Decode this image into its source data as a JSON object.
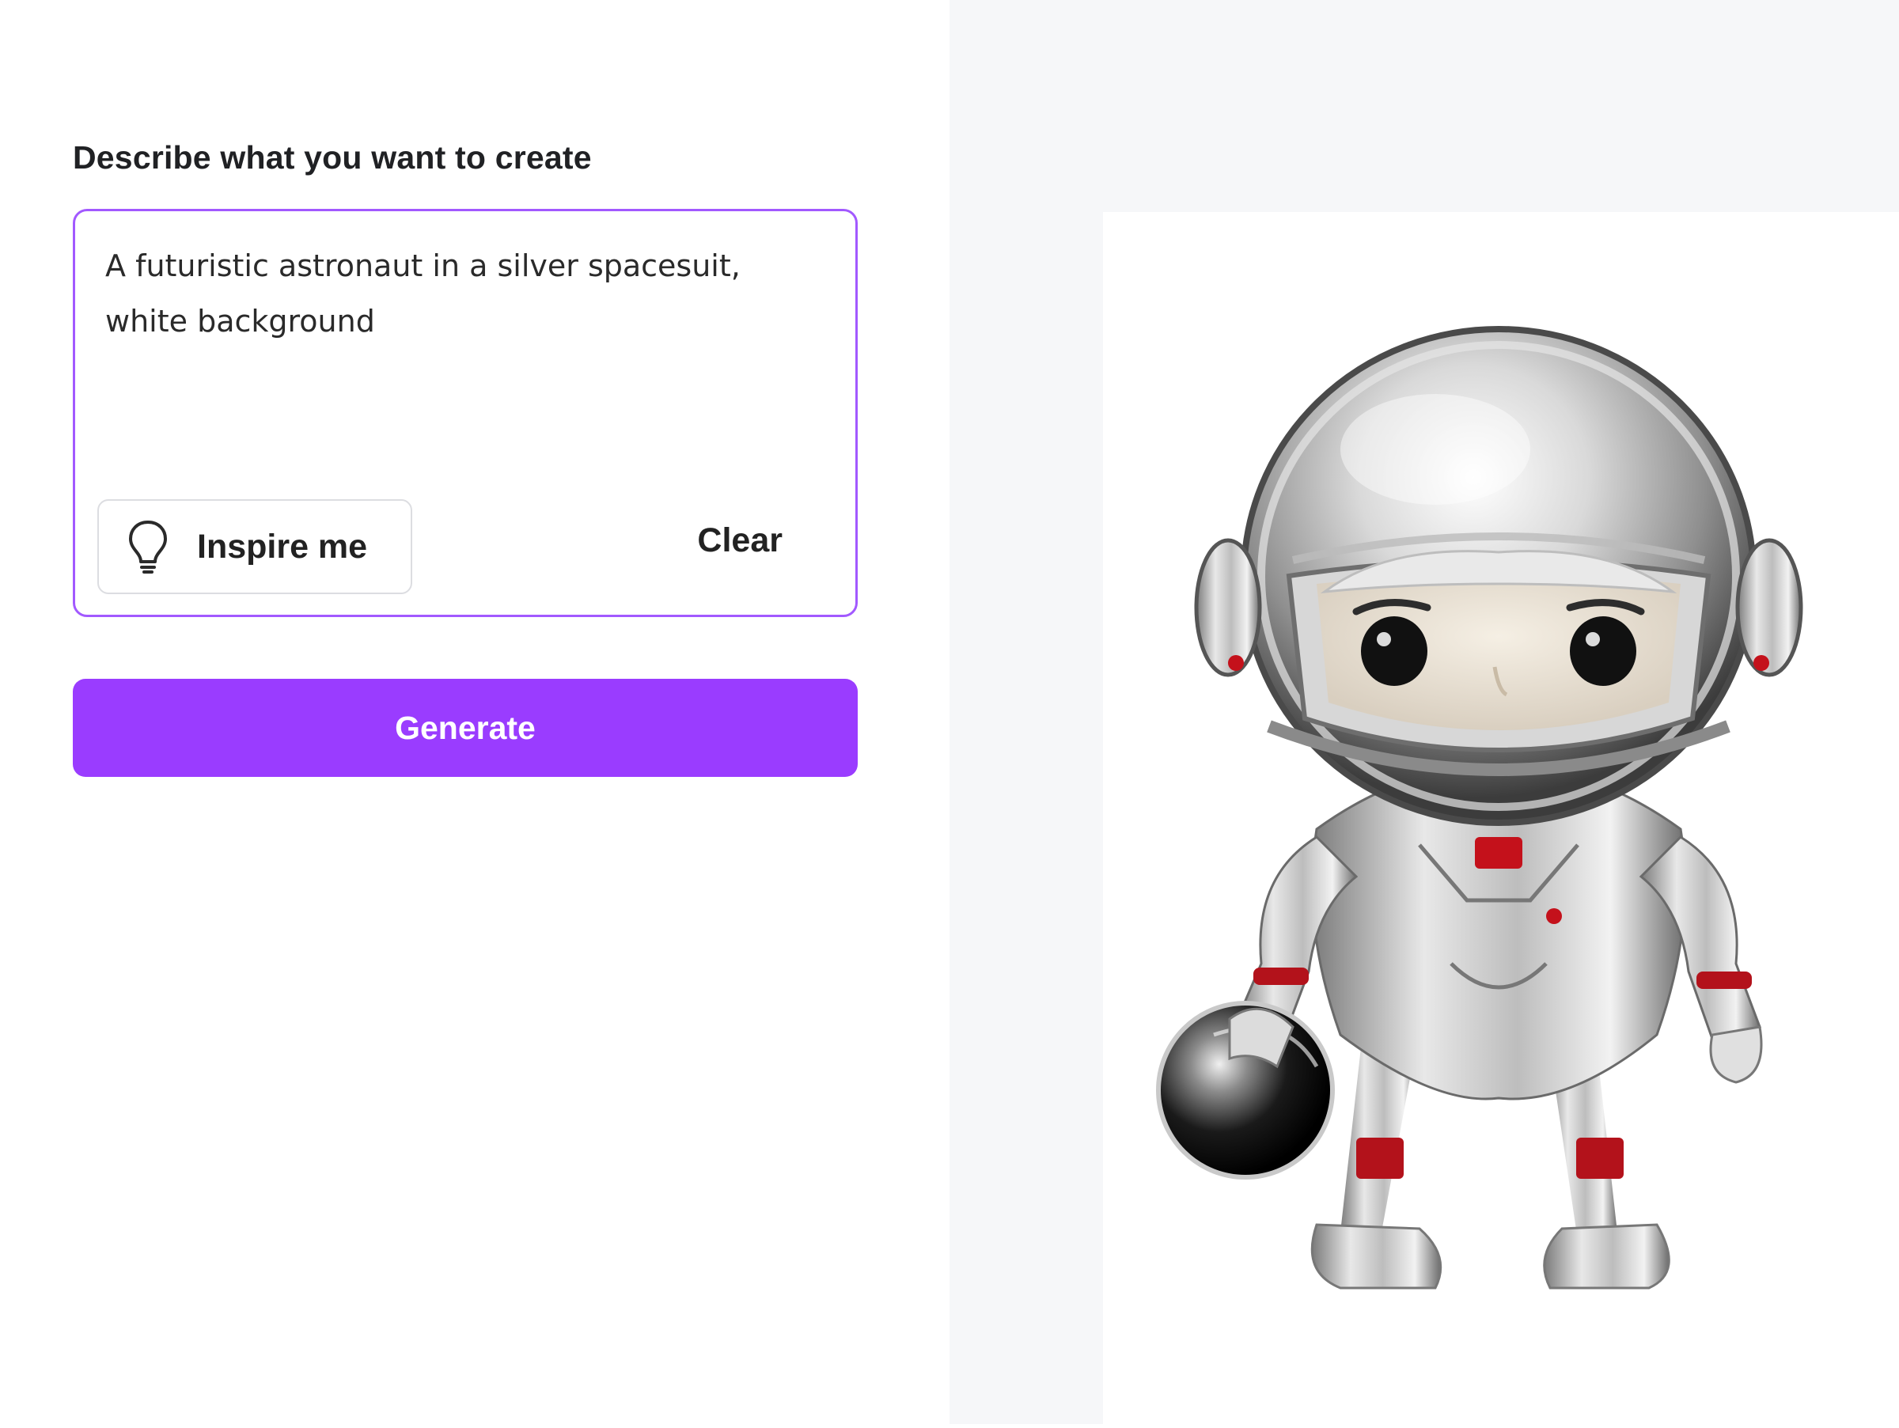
{
  "prompt": {
    "label": "Describe what you want to create",
    "value": "A futuristic astronaut in a silver spacesuit,\nwhite background"
  },
  "actions": {
    "inspire_label": "Inspire me",
    "inspire_icon": "lightbulb-icon",
    "clear_label": "Clear",
    "generate_label": "Generate"
  },
  "colors": {
    "accent": "#9a3cff",
    "input_border": "#a259ff"
  },
  "result": {
    "subject": "astronaut-figure"
  }
}
